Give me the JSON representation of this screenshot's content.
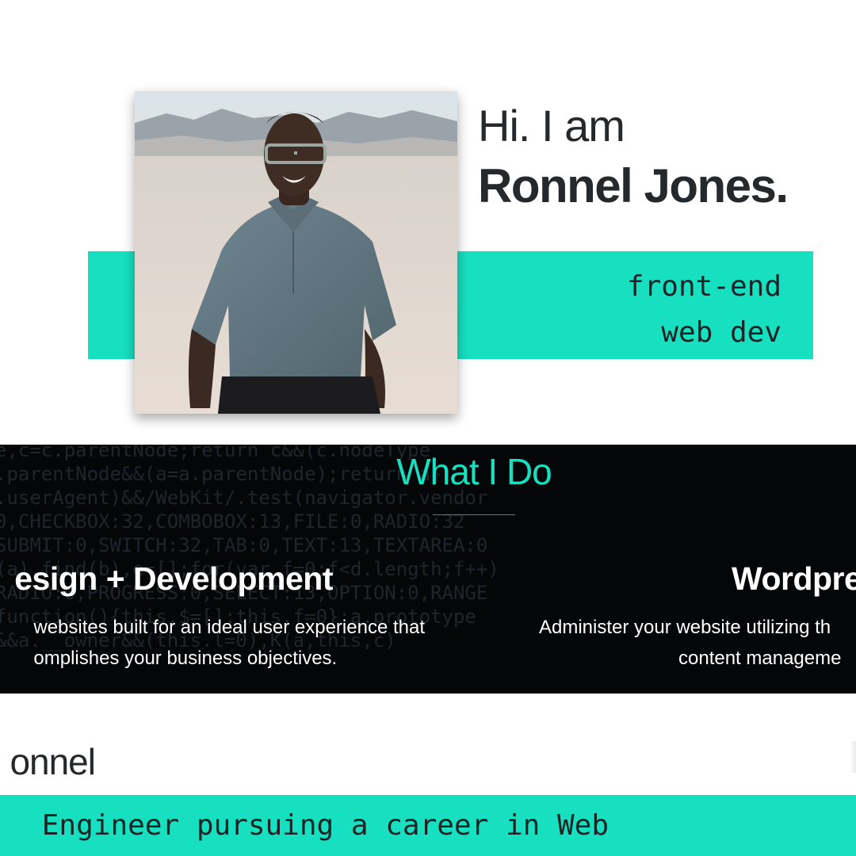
{
  "hero": {
    "greeting": "Hi. I am",
    "name": "Ronnel Jones.",
    "tagline_line1": "front-end",
    "tagline_line2": "web dev",
    "accent_color": "#17e0c0"
  },
  "services": {
    "heading": "What I Do",
    "items": [
      {
        "title": "esign + Development",
        "desc_line1": "websites built for an ideal user experience that",
        "desc_line2": "omplishes your business objectives."
      },
      {
        "title": "Wordpre",
        "desc_line1": "Administer your website utilizing th",
        "desc_line2": "content manageme"
      }
    ]
  },
  "about": {
    "heading": "onnel",
    "text": "Engineer pursuing a career in Web"
  }
}
